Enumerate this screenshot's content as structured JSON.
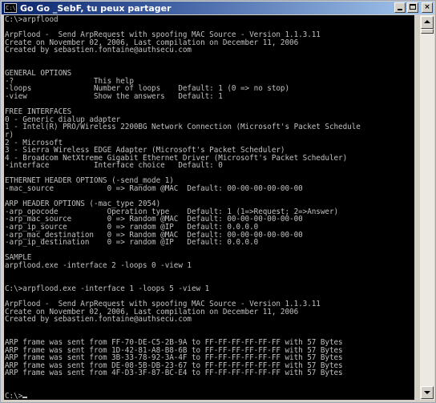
{
  "window": {
    "title": "Go Go _SebF, tu peux partager",
    "icon": "console-icon",
    "buttons": [
      "minimize",
      "maximize",
      "close"
    ],
    "close_label": "×"
  },
  "console": {
    "lines": [
      "C:\\>arpflood",
      "",
      "ArpFlood -  Send ArpRequest with spoofing MAC Source - Version 1.1.3.11",
      "Create on November 02, 2006, Last compilation on December 11, 2006",
      "Created by sebastien.fontaine@authsecu.com",
      "",
      "",
      "GENERAL OPTIONS",
      "-?                  This help",
      "-loops              Number of loops    Default: 1 (0 => no stop)",
      "-view               Show the answers   Default: 1",
      "",
      "FREE INTERFACES",
      "0 - Generic dialup adapter",
      "1 - Intel(R) PRO/Wireless 2200BG Network Connection (Microsoft's Packet Schedule",
      "r)",
      "2 - Microsoft",
      "3 - Sierra Wireless EDGE Adapter (Microsoft's Packet Scheduler)",
      "4 - Broadcom NetXtreme Gigabit Ethernet Driver (Microsoft's Packet Scheduler)",
      "-interface          Interface choice   Default: 0",
      "",
      "ETHERNET HEADER OPTIONS (-send_mode 1)",
      "-mac_source            0 => Random @MAC  Default: 00-00-00-00-00-00",
      "",
      "ARP HEADER OPTIONS (-mac_type 2054)",
      "-arp_opocode           Operation type    Default: 1 (1=>Request; 2=>Answer)",
      "-arp_mac_source        0 => Random @MAC  Default: 00-00-00-00-00-00",
      "-arp_ip_source         0 => random @IP   Default: 0.0.0.0",
      "-arp_mac_destination   0 => Random @MAC  Default: 00-00-00-00-00-00",
      "-arp_ip_destination    0 => random @IP   Default: 0.0.0.0",
      "",
      "SAMPLE",
      "arpflood.exe -interface 2 -loops 0 -view 1",
      "",
      "",
      "C:\\>arpflood.exe -interface 1 -loops 5 -view 1",
      "",
      "ArpFlood -  Send ArpRequest with spoofing MAC Source - Version 1.1.3.11",
      "Create on November 02, 2006, Last compilation on December 11, 2006",
      "Created by sebastien.fontaine@authsecu.com",
      "",
      "",
      "ARP frame was sent from FF-70-DE-C5-2B-9A to FF-FF-FF-FF-FF-FF with 57 Bytes",
      "ARP frame was sent from 1D-42-81-A8-B8-6B to FF-FF-FF-FF-FF-FF with 57 Bytes",
      "ARP frame was sent from 3B-33-78-92-3A-4F to FF-FF-FF-FF-FF-FF with 57 Bytes",
      "ARP frame was sent from DE-08-5B-DB-23-67 to FF-FF-FF-FF-FF-FF with 57 Bytes",
      "ARP frame was sent from 4F-D3-3F-87-BC-E4 to FF-FF-FF-FF-FF-FF with 57 Bytes",
      "",
      ""
    ],
    "prompt": "C:\\>",
    "text_color": "#c0c0c0",
    "background_color": "#000000"
  },
  "scrollbar": {
    "position": 1.0
  }
}
